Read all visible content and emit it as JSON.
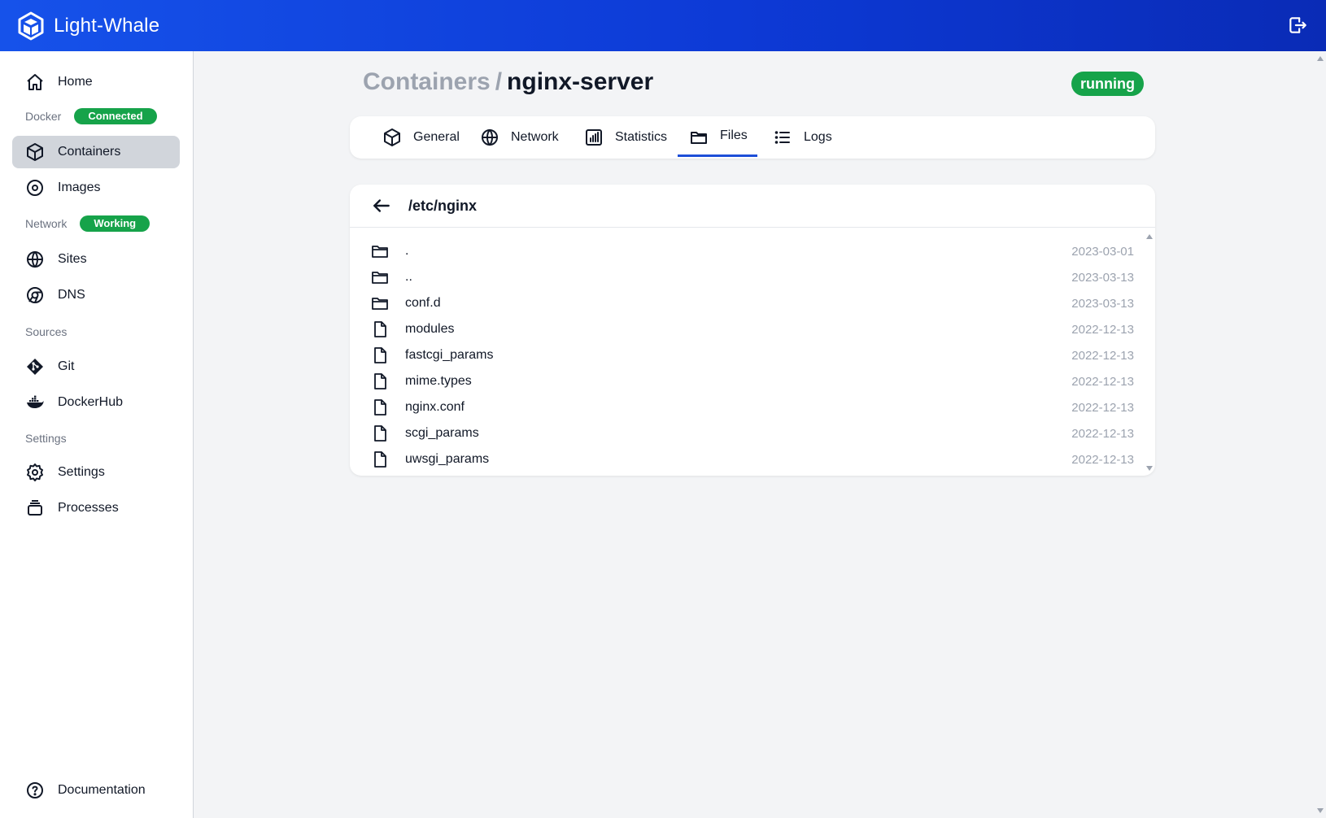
{
  "app": {
    "name": "Light-Whale"
  },
  "sidebar": {
    "home": "Home",
    "docker_section": "Docker",
    "docker_status": "Connected",
    "containers": "Containers",
    "images": "Images",
    "network_section": "Network",
    "network_status": "Working",
    "sites": "Sites",
    "dns": "DNS",
    "sources_section": "Sources",
    "git": "Git",
    "dockerhub": "DockerHub",
    "settings_section": "Settings",
    "settings": "Settings",
    "processes": "Processes",
    "documentation": "Documentation"
  },
  "breadcrumb": {
    "parent": "Containers",
    "separator": "/",
    "current": "nginx-server"
  },
  "status": {
    "label": "running",
    "color": "#16a34a"
  },
  "tabs": [
    {
      "label": "General",
      "icon": "cube-icon"
    },
    {
      "label": "Network",
      "icon": "globe-icon"
    },
    {
      "label": "Statistics",
      "icon": "chart-icon"
    },
    {
      "label": "Files",
      "icon": "folder-icon",
      "active": true
    },
    {
      "label": "Logs",
      "icon": "list-icon"
    }
  ],
  "files": {
    "path": "/etc/nginx",
    "rows": [
      {
        "name": ".",
        "date": "2023-03-01",
        "type": "folder"
      },
      {
        "name": "..",
        "date": "2023-03-13",
        "type": "folder"
      },
      {
        "name": "conf.d",
        "date": "2023-03-13",
        "type": "folder"
      },
      {
        "name": "modules",
        "date": "2022-12-13",
        "type": "file"
      },
      {
        "name": "fastcgi_params",
        "date": "2022-12-13",
        "type": "file"
      },
      {
        "name": "mime.types",
        "date": "2022-12-13",
        "type": "file"
      },
      {
        "name": "nginx.conf",
        "date": "2022-12-13",
        "type": "file"
      },
      {
        "name": "scgi_params",
        "date": "2022-12-13",
        "type": "file"
      },
      {
        "name": "uwsgi_params",
        "date": "2022-12-13",
        "type": "file"
      }
    ]
  },
  "colors": {
    "accent": "#1d4ed8",
    "success": "#16a34a",
    "topbar": "#1652ea"
  }
}
